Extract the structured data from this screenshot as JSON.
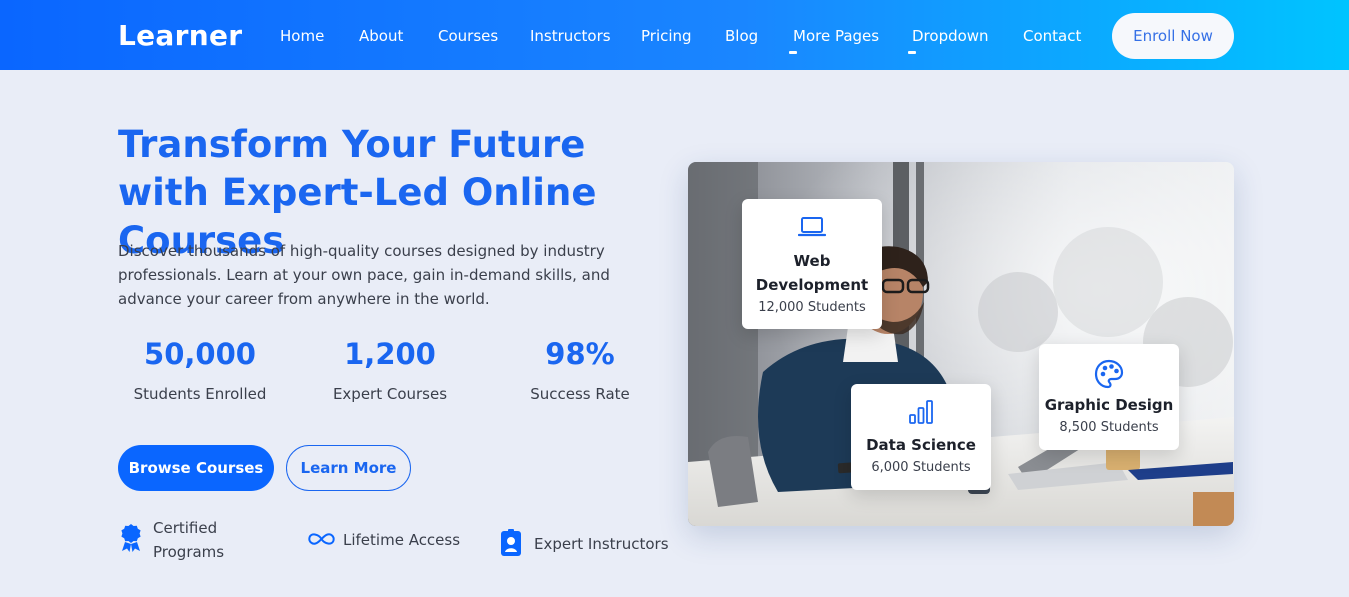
{
  "header": {
    "logo": "Learner",
    "nav": [
      {
        "label": "Home"
      },
      {
        "label": "About"
      },
      {
        "label": "Courses"
      },
      {
        "label": "Instructors"
      },
      {
        "label": "Pricing"
      },
      {
        "label": "Blog"
      },
      {
        "label": "More Pages"
      },
      {
        "label": "Dropdown"
      },
      {
        "label": "Contact"
      }
    ],
    "cta": "Enroll Now"
  },
  "hero": {
    "title": "Transform Your Future with Expert-Led Online Courses",
    "description": "Discover thousands of high-quality courses designed by industry professionals. Learn at your own pace, gain in-demand skills, and advance your career from anywhere in the world.",
    "stats": [
      {
        "value": "50,000",
        "label": "Students Enrolled"
      },
      {
        "value": "1,200",
        "label": "Expert Courses"
      },
      {
        "value": "98%",
        "label": "Success Rate"
      }
    ],
    "buttons": {
      "primary": "Browse Courses",
      "secondary": "Learn More"
    },
    "features": [
      {
        "icon": "award-ribbon-icon",
        "label": "Certified Programs"
      },
      {
        "icon": "infinity-icon",
        "label": "Lifetime Access"
      },
      {
        "icon": "id-badge-icon",
        "label": "Expert Instructors"
      }
    ]
  },
  "cards": [
    {
      "icon": "laptop-icon",
      "title": "Web Development",
      "students": "12,000 Students"
    },
    {
      "icon": "bar-chart-icon",
      "title": "Data Science",
      "students": "6,000 Students"
    },
    {
      "icon": "palette-icon",
      "title": "Graphic Design",
      "students": "8,500 Students"
    }
  ],
  "colors": {
    "primary": "#0a66ff",
    "gradient_end": "#00c4ff",
    "background": "#e9edf7"
  }
}
